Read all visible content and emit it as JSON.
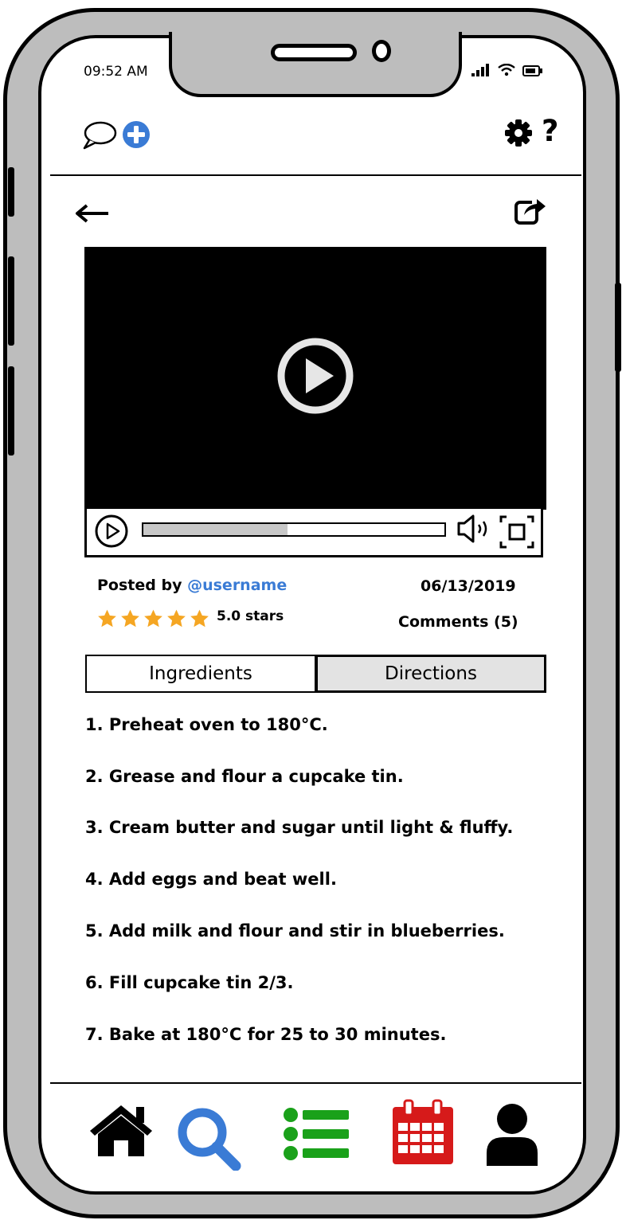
{
  "status_bar": {
    "time": "09:52 AM"
  },
  "header": {
    "comment_icon": "chat-bubble-icon",
    "add_icon": "plus-circle-icon",
    "settings_icon": "gear-icon",
    "help_label": "?"
  },
  "video": {
    "progress": 0.48
  },
  "post": {
    "posted_by_label": "Posted by",
    "username": "@username",
    "date": "06/13/2019",
    "rating": 5,
    "rating_text": "5.0 stars",
    "comments": "Comments (5)"
  },
  "tabs": [
    {
      "label": "Ingredients",
      "active": false
    },
    {
      "label": "Directions",
      "active": true
    }
  ],
  "directions": [
    "1. Preheat oven to 180°C.",
    "2. Grease and flour a cupcake tin.",
    "3. Cream butter and sugar until light & fluffy.",
    "4. Add eggs and beat well.",
    "5. Add milk and flour and stir in blueberries.",
    "6. Fill cupcake tin 2/3.",
    "7. Bake at 180°C for 25 to 30 minutes."
  ],
  "bottom_nav": [
    {
      "icon": "home-icon",
      "color": "#000000"
    },
    {
      "icon": "search-icon",
      "color": "#3a7bd5"
    },
    {
      "icon": "list-icon",
      "color": "#1aa11a"
    },
    {
      "icon": "calendar-icon",
      "color": "#d61a1a"
    },
    {
      "icon": "user-icon",
      "color": "#000000"
    }
  ],
  "colors": {
    "accent": "#3a7bd5",
    "star": "#f5a623"
  }
}
